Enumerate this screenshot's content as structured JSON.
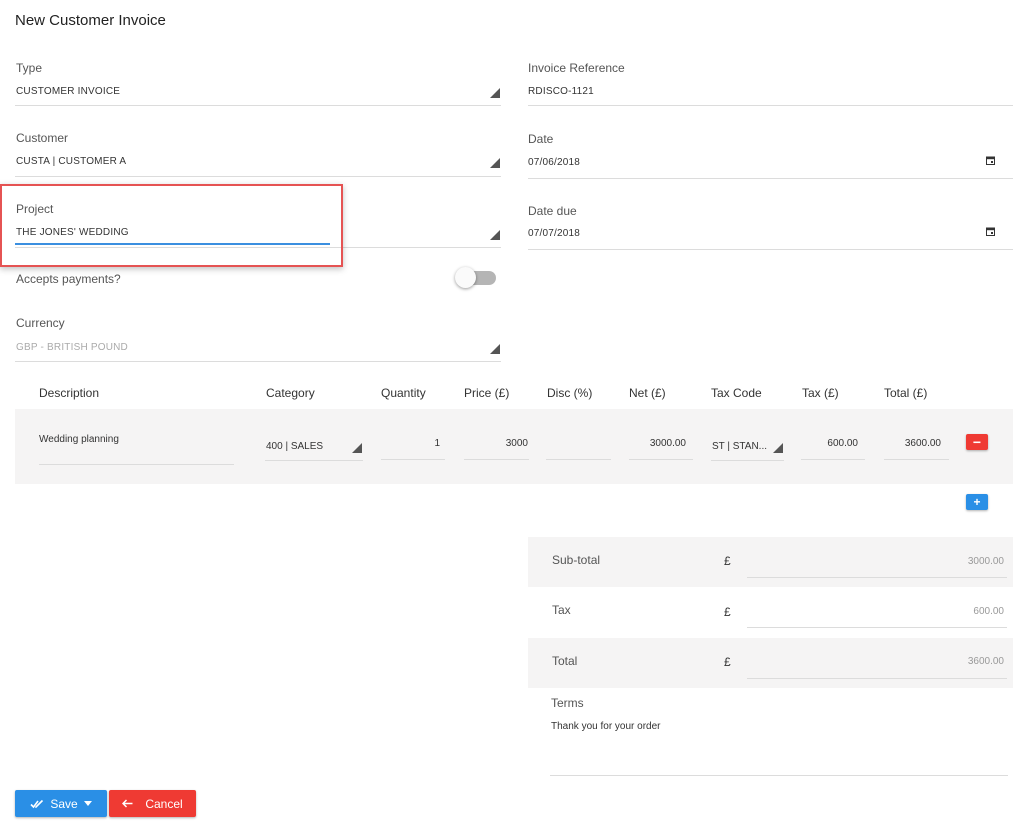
{
  "page": {
    "title": "New Customer Invoice"
  },
  "form": {
    "type": {
      "label": "Type",
      "value": "CUSTOMER INVOICE"
    },
    "customer": {
      "label": "Customer",
      "value": "CUSTA | CUSTOMER A"
    },
    "project": {
      "label": "Project",
      "value": "THE JONES' WEDDING"
    },
    "accepts_payments": {
      "label": "Accepts payments?",
      "on": false
    },
    "currency": {
      "label": "Currency",
      "value": "GBP - BRITISH POUND"
    },
    "invoice_reference": {
      "label": "Invoice Reference",
      "value": "RDISCO-1121"
    },
    "date": {
      "label": "Date",
      "value": "07/06/2018"
    },
    "date_due": {
      "label": "Date due",
      "value": "07/07/2018"
    }
  },
  "table": {
    "headers": {
      "description": "Description",
      "category": "Category",
      "quantity": "Quantity",
      "price": "Price (£)",
      "disc": "Disc (%)",
      "net": "Net (£)",
      "tax_code": "Tax Code",
      "tax": "Tax (£)",
      "total": "Total (£)"
    },
    "rows": [
      {
        "description": "Wedding planning",
        "category": "400 | SALES",
        "quantity": "1",
        "price": "3000",
        "disc": "",
        "net": "3000.00",
        "tax_code": "ST | STAN...",
        "tax": "600.00",
        "total": "3600.00"
      }
    ],
    "remove_label": "−",
    "add_label": "+"
  },
  "summary": {
    "currency_symbol": "£",
    "subtotal": {
      "label": "Sub-total",
      "value": "3000.00"
    },
    "tax": {
      "label": "Tax",
      "value": "600.00"
    },
    "total": {
      "label": "Total",
      "value": "3600.00"
    },
    "terms": {
      "label": "Terms",
      "value": "Thank you for your order"
    }
  },
  "actions": {
    "save_label": "Save",
    "cancel_label": "Cancel",
    "icons": {
      "save": "double-check-icon",
      "save_menu": "caret-down-icon",
      "cancel": "arrow-left-icon"
    }
  },
  "colors": {
    "primary": "#2a8fe6",
    "danger": "#ef3a33",
    "highlight": "#e55353",
    "active_underline": "#3b8fe0"
  }
}
